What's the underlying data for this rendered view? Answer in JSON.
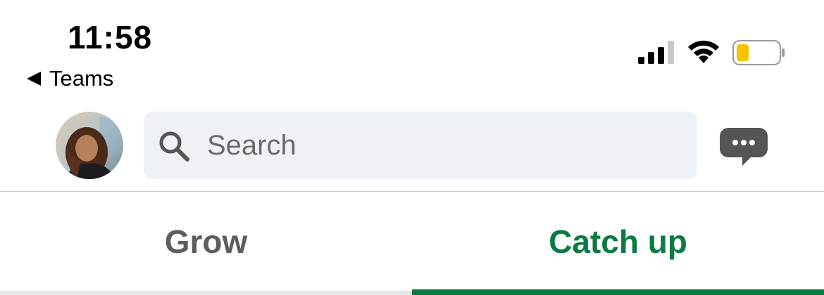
{
  "status_bar": {
    "time": "11:58",
    "signal_bars_active": 3,
    "signal_bars_total": 4,
    "battery_level_fraction": 0.2,
    "battery_color": "#f5c400"
  },
  "back_nav": {
    "label": "Teams"
  },
  "header": {
    "search_placeholder": "Search"
  },
  "tabs": [
    {
      "label": "Grow",
      "active": false
    },
    {
      "label": "Catch up",
      "active": true
    }
  ],
  "colors": {
    "accent": "#0c7a43",
    "search_bg": "#eef2f6",
    "inactive_tab": "#5e5e5e"
  }
}
